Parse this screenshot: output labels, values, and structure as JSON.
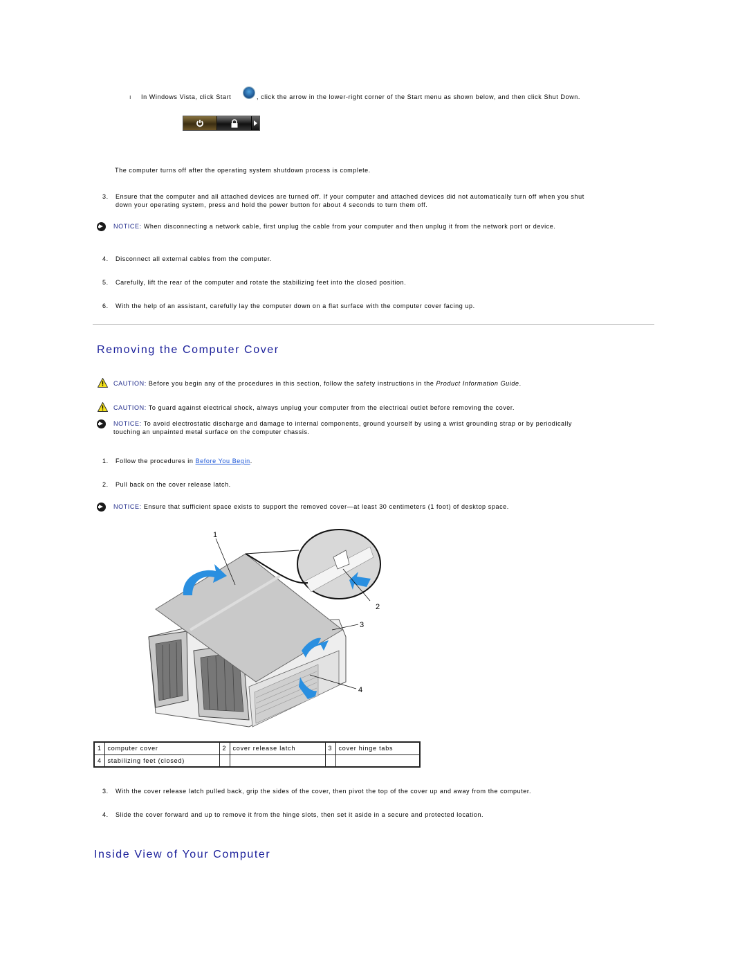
{
  "vista_step": {
    "bullet": "ı",
    "text_before": "In Windows Vista, click Start",
    "text_after": ", click the arrow in the lower-right corner of the Start menu as shown below, and then click Shut Down.",
    "icons": [
      "windows-start-orb-icon",
      "power-icon",
      "lock-icon",
      "arrow-right-icon"
    ]
  },
  "shutdown_note": "The computer turns off after the operating system shutdown process is complete.",
  "steps_a": [
    {
      "num": "3.",
      "text": "Ensure that the computer and all attached devices are turned off. If your computer and attached devices did not automatically turn off when you shut",
      "text2": "down your operating system, press and hold the power button for about 4 seconds to turn them off."
    },
    {
      "num": "4.",
      "text": "Disconnect all external cables from the computer."
    },
    {
      "num": "5.",
      "text": "Carefully, lift the rear of the computer and rotate the stabilizing feet into the closed position."
    },
    {
      "num": "6.",
      "text": "With the help of an assistant, carefully lay the computer down on a flat surface with the computer cover facing up."
    }
  ],
  "notice_network": {
    "label": "NOTICE:",
    "text": "When disconnecting a network cable, first unplug the cable from your computer and then unplug it from the network port or device."
  },
  "section1": {
    "title": "Removing the Computer Cover",
    "caution1": {
      "label": "CAUTION:",
      "text": "Before you begin any of the procedures in this section, follow the safety instructions in the",
      "italic": "Product Information Guide",
      "end": "."
    },
    "caution2": {
      "label": "CAUTION:",
      "text": "To guard against electrical shock, always unplug your computer from the electrical outlet before removing the cover."
    },
    "notice_esd": {
      "label": "NOTICE:",
      "text": "To avoid electrostatic discharge and damage to internal components, ground yourself by using a wrist grounding strap or by periodically",
      "text2": "touching an unpainted metal surface on the computer chassis."
    },
    "step1": {
      "num": "1.",
      "text": "Follow the procedures in",
      "link": "Before You Begin",
      "end": "."
    },
    "step2": {
      "num": "2.",
      "text": "Pull back on the cover release latch."
    },
    "notice_space": {
      "label": "NOTICE:",
      "text": "Ensure that sufficient space exists to support the removed cover—at least 30 centimeters (1 foot) of desktop space."
    },
    "figure_callouts": [
      "1",
      "2",
      "3",
      "4"
    ],
    "legend": [
      [
        {
          "n": "1",
          "label": "computer cover"
        },
        {
          "n": "2",
          "label": "cover release latch"
        },
        {
          "n": "3",
          "label": "cover hinge tabs"
        }
      ],
      [
        {
          "n": "4",
          "label": "stabilizing feet (closed)"
        },
        {
          "n": "",
          "label": ""
        },
        {
          "n": "",
          "label": ""
        }
      ]
    ],
    "step3": {
      "num": "3.",
      "text": "With the cover release latch pulled back, grip the sides of the cover, then pivot the top of the cover up and away from the computer."
    },
    "step4": {
      "num": "4.",
      "text": "Slide the cover forward and up to remove it from the hinge slots, then set it aside in a secure and protected location."
    }
  },
  "section2": {
    "title": "Inside View of Your Computer"
  },
  "colors": {
    "heading": "#1a1f9a",
    "notice_label": "#1f2a8a",
    "link": "#1a55d8",
    "arrow_blue": "#2a8fe0"
  }
}
